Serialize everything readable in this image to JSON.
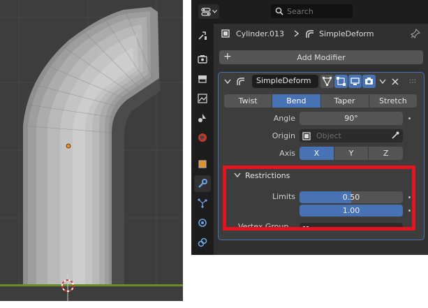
{
  "search": {
    "placeholder": "Search"
  },
  "breadcrumb": {
    "object": "Cylinder.013",
    "modifier": "SimpleDeform"
  },
  "add_modifier_label": "Add Modifier",
  "modifier": {
    "name": "SimpleDeform",
    "modes": [
      "Twist",
      "Bend",
      "Taper",
      "Stretch"
    ],
    "active_mode": "Bend",
    "angle": {
      "label": "Angle",
      "value": "90°"
    },
    "origin": {
      "label": "Origin",
      "placeholder": "Object"
    },
    "axis": {
      "label": "Axis",
      "options": [
        "X",
        "Y",
        "Z"
      ],
      "active": "X"
    },
    "restrictions": {
      "title": "Restrictions",
      "limits_label": "Limits",
      "limit_min": "0.50",
      "limit_max": "1.00",
      "limit_min_fill": 0.5,
      "limit_max_fill": 1.0,
      "vertex_group_label": "Vertex Group"
    }
  },
  "colors": {
    "accent": "#4772b3",
    "highlight_box": "#e3141e",
    "viewport_bg": "#3d3d3d",
    "panel_bg": "#303030"
  },
  "icons": {
    "sidebar_tabs": [
      "tool-icon",
      "render-icon",
      "output-icon",
      "view-layer-icon",
      "scene-icon",
      "world-icon",
      "object-icon",
      "modifier-icon",
      "particles-icon",
      "physics-icon",
      "constraints-icon"
    ]
  }
}
